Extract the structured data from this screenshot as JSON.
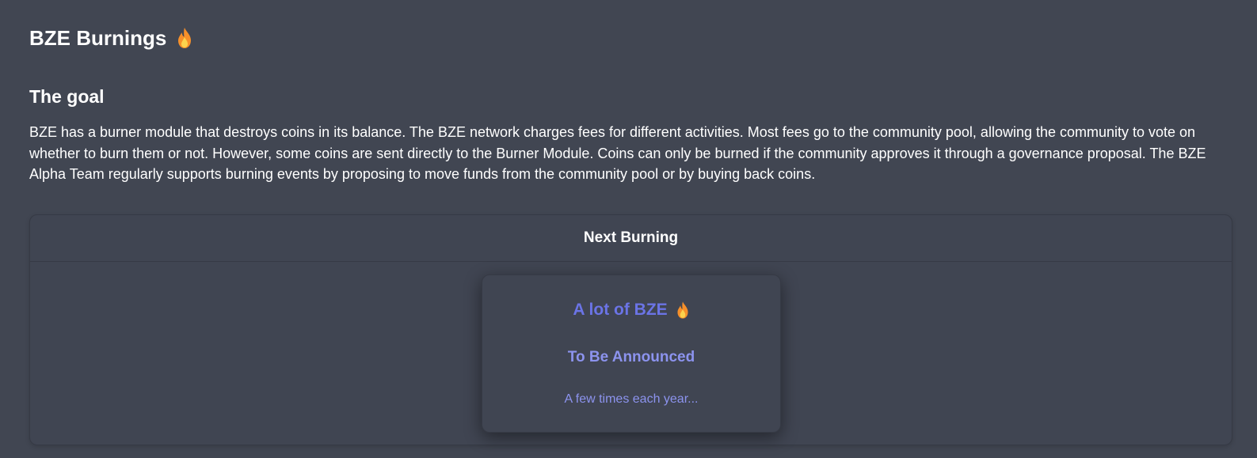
{
  "page": {
    "title": "BZE Burnings",
    "title_icon": "fire-emoji"
  },
  "goal": {
    "heading": "The goal",
    "text": "BZE has a burner module that destroys coins in its balance. The BZE network charges fees for different activities. Most fees go to the community pool, allowing the community to vote on whether to burn them or not. However, some coins are sent directly to the Burner Module. Coins can only be burned if the community approves it through a governance proposal. The BZE Alpha Team regularly supports burning events by proposing to move funds from the community pool or by buying back coins."
  },
  "next_burning": {
    "header": "Next Burning",
    "amount": "A lot of BZE",
    "amount_icon": "fire-emoji",
    "status": "To Be Announced",
    "frequency": "A few times each year..."
  },
  "colors": {
    "background": "#414652",
    "accent": "#6b74e6",
    "accent_light": "#8c93ee",
    "flame_outer": "#f7902a",
    "flame_inner": "#fcd34d"
  }
}
